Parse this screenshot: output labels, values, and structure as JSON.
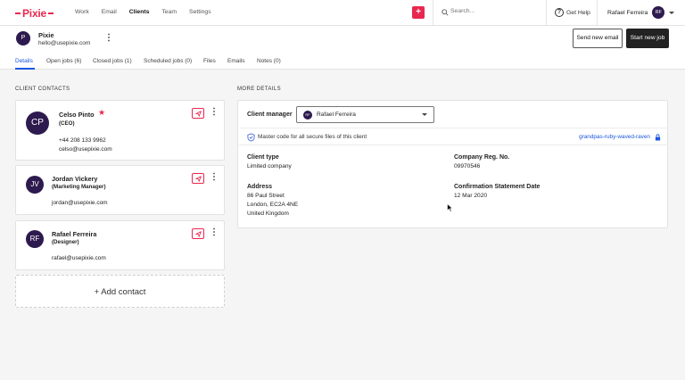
{
  "brand": {
    "name": "Pixie",
    "accent": "#e8284f",
    "dark_avatar": "#2d1a4e",
    "link_blue": "#1a56e0"
  },
  "nav": {
    "items": [
      "Work",
      "Email",
      "Clients",
      "Team",
      "Settings"
    ],
    "active": "Clients"
  },
  "topbar": {
    "search_placeholder": "Search...",
    "help_label": "Get Help",
    "user_name": "Rafael Ferreira",
    "user_initials": "RF"
  },
  "client": {
    "initial": "P",
    "name": "Pixie",
    "email": "hello@usepixie.com",
    "send_email_label": "Send new email",
    "start_job_label": "Start new job"
  },
  "tabs": [
    "Details",
    "Open jobs (6)",
    "Closed jobs (1)",
    "Scheduled jobs (0)",
    "Files",
    "Emails",
    "Notes (0)"
  ],
  "contacts_section": {
    "title": "CLIENT CONTACTS",
    "contacts": [
      {
        "initials": "CP",
        "name": "Celso Pinto",
        "role": "(CEO)",
        "phone": "+44 208 133 9962",
        "email": "celso@usepixie.com",
        "primary": true
      },
      {
        "initials": "JV",
        "name": "Jordan Vickery",
        "role": "(Marketing Manager)",
        "email": "jordan@usepixie.com"
      },
      {
        "initials": "RF",
        "name": "Rafael Ferreira",
        "role": "(Designer)",
        "email": "rafael@usepixie.com"
      }
    ],
    "add_contact_label": "+ Add contact"
  },
  "details_section": {
    "title": "MORE DETAILS",
    "client_manager_label": "Client manager",
    "client_manager_value": "Rafael Ferreira",
    "client_manager_initials": "RF",
    "master_code_label": "Master code for all secure files of this client",
    "master_code_value": "grandpas-ruby-waved-raven",
    "client_type_label": "Client type",
    "client_type_value": "Limited company",
    "company_reg_label": "Company Reg. No.",
    "company_reg_value": "09970546",
    "address_label": "Address",
    "address_lines": [
      "86 Paul Street",
      "London, EC2A 4NE",
      "United Kingdom"
    ],
    "confirmation_label": "Confirmation Statement Date",
    "confirmation_value": "12 Mar 2020"
  }
}
